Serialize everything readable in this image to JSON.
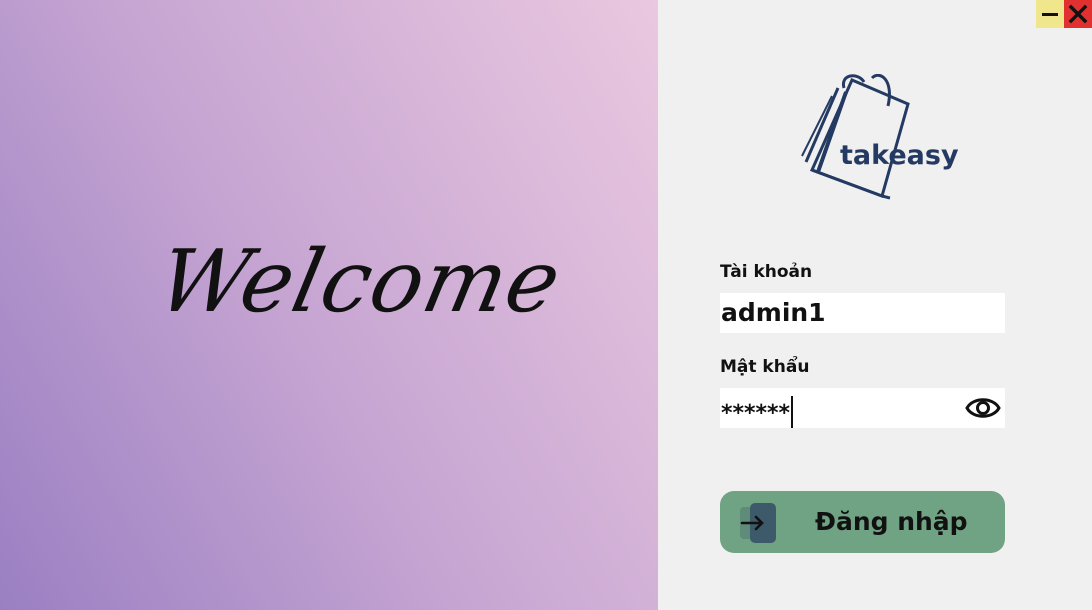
{
  "welcome": {
    "text": "Welcome"
  },
  "window_controls": {
    "minimize_icon": "minimize-icon",
    "close_icon": "close-icon"
  },
  "brand": {
    "name": "takeasy",
    "icon": "shopping-bag-icon"
  },
  "form": {
    "username_label": "Tài khoản",
    "username_value": "admin1",
    "password_label": "Mật khẩu",
    "password_value": "******",
    "show_password_icon": "eye-icon"
  },
  "login": {
    "label": "Đăng nhập",
    "icon": "login-arrow-icon"
  },
  "colors": {
    "button": "#70a383",
    "brand": "#243a63",
    "close": "#e03030",
    "minimize": "#f0e68c"
  }
}
